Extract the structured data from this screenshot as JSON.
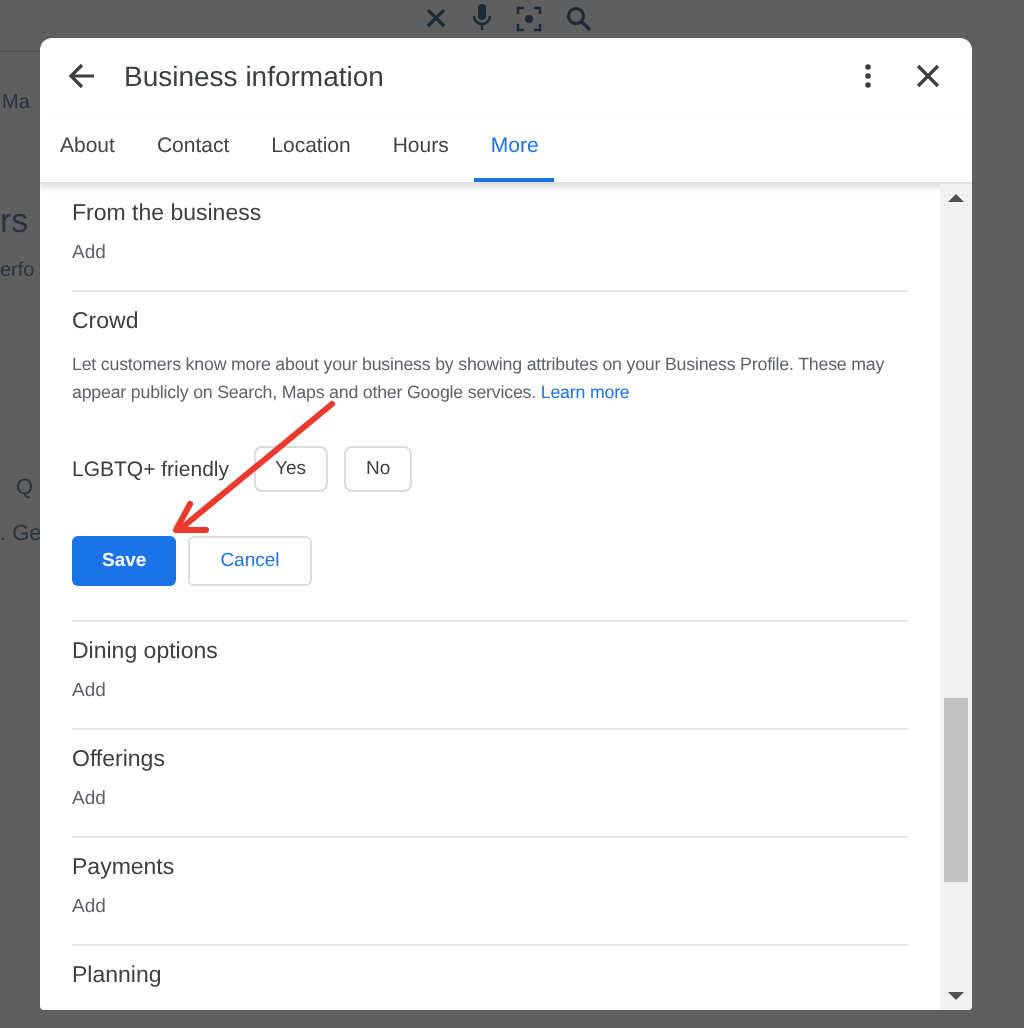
{
  "backdrop": {
    "texts": [
      "Ma",
      "rs",
      "erfo",
      "Q",
      ". Ge"
    ]
  },
  "dialog": {
    "title": "Business information",
    "tabs": [
      {
        "label": "About",
        "selected": false
      },
      {
        "label": "Contact",
        "selected": false
      },
      {
        "label": "Location",
        "selected": false
      },
      {
        "label": "Hours",
        "selected": false
      },
      {
        "label": "More",
        "selected": true
      }
    ],
    "sections": [
      {
        "kind": "attribute",
        "title": "From the business",
        "action": "Add"
      },
      {
        "kind": "editing",
        "title": "Crowd",
        "description": "Let customers know more about your business by showing attributes on your Business Profile. These may appear publicly on Search, Maps and other Google services.",
        "link": "Learn more",
        "attribute": {
          "label": "LGBTQ+ friendly",
          "options": [
            {
              "label": "Yes",
              "selected": false
            },
            {
              "label": "No",
              "selected": false
            }
          ]
        },
        "save": "Save",
        "cancel": "Cancel"
      },
      {
        "kind": "attribute",
        "title": "Dining options",
        "action": "Add"
      },
      {
        "kind": "attribute",
        "title": "Offerings",
        "action": "Add"
      },
      {
        "kind": "attribute",
        "title": "Payments",
        "action": "Add"
      },
      {
        "kind": "attribute",
        "title": "Planning"
      }
    ]
  }
}
